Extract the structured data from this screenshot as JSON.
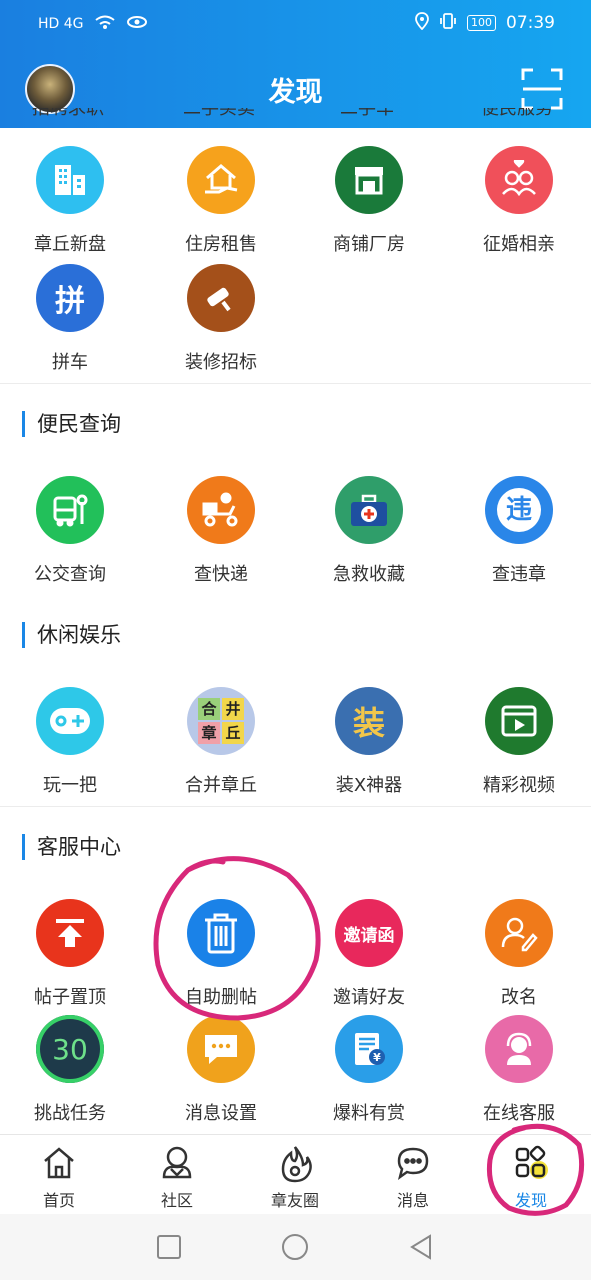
{
  "status_bar": {
    "network": "HD 4G",
    "time": "07:39",
    "battery": "100"
  },
  "header": {
    "title": "发现"
  },
  "partial_row": [
    "招聘求职",
    "二手买卖",
    "二手车",
    "便民服务"
  ],
  "section_top": {
    "rows": [
      [
        {
          "label": "章丘新盘",
          "icon": "building-icon",
          "color": "#2ebff0"
        },
        {
          "label": "住房租售",
          "icon": "house-hand-icon",
          "color": "#f6a21c"
        },
        {
          "label": "商铺厂房",
          "icon": "storefront-icon",
          "color": "#1a7a3a"
        },
        {
          "label": "征婚相亲",
          "icon": "couple-icon",
          "color": "#f0505a"
        }
      ],
      [
        {
          "label": "拼车",
          "icon": "carpool-icon",
          "color": "#2a6fd8"
        },
        {
          "label": "装修招标",
          "icon": "paint-roller-icon",
          "color": "#a4501a"
        }
      ]
    ]
  },
  "section_convenience": {
    "title": "便民查询",
    "items": [
      {
        "label": "公交查询",
        "icon": "bus-icon",
        "color": "#22c05a"
      },
      {
        "label": "查快递",
        "icon": "delivery-scooter-icon",
        "color": "#f07a1a"
      },
      {
        "label": "急救收藏",
        "icon": "first-aid-kit-icon",
        "color": "#2f9e6a"
      },
      {
        "label": "查违章",
        "icon": "violation-search-icon",
        "color": "#2a86e8",
        "glyph": "违"
      }
    ]
  },
  "section_entertainment": {
    "title": "休闲娱乐",
    "items": [
      {
        "label": "玩一把",
        "icon": "gamepad-icon",
        "color": "#2ec8e8"
      },
      {
        "label": "合并章丘",
        "icon": "merge-puzzle-icon",
        "color": "#b8c8e8",
        "tiles": [
          "合",
          "井",
          "章",
          "丘"
        ]
      },
      {
        "label": "装X神器",
        "icon": "zhuang-icon",
        "color": "#3a6fb0",
        "glyph": "装"
      },
      {
        "label": "精彩视频",
        "icon": "video-play-icon",
        "color": "#1f7a2e"
      }
    ]
  },
  "section_service": {
    "title": "客服中心",
    "rows": [
      [
        {
          "label": "帖子置顶",
          "icon": "pin-top-icon",
          "color": "#e8341c"
        },
        {
          "label": "自助删帖",
          "icon": "trash-icon",
          "color": "#1a82e8"
        },
        {
          "label": "邀请好友",
          "icon": "invite-icon",
          "color": "#e8285c",
          "glyph": "邀请函"
        },
        {
          "label": "改名",
          "icon": "rename-icon",
          "color": "#f07a1a"
        }
      ],
      [
        {
          "label": "挑战任务",
          "icon": "challenge-30-icon",
          "color": "#1e3a4a",
          "glyph": "30"
        },
        {
          "label": "消息设置",
          "icon": "message-settings-icon",
          "color": "#f0a21c"
        },
        {
          "label": "爆料有赏",
          "icon": "reward-news-icon",
          "color": "#2a9ee8"
        },
        {
          "label": "在线客服",
          "icon": "customer-service-icon",
          "color": "#e86aa8"
        }
      ]
    ]
  },
  "bottom_nav": [
    {
      "label": "首页",
      "icon": "home-icon"
    },
    {
      "label": "社区",
      "icon": "community-icon"
    },
    {
      "label": "章友圈",
      "icon": "fire-circle-icon"
    },
    {
      "label": "消息",
      "icon": "chat-icon"
    },
    {
      "label": "发现",
      "icon": "discover-grid-icon",
      "active": true
    }
  ],
  "colors": {
    "accent": "#1a87e6",
    "annotation": "#d8287a"
  }
}
